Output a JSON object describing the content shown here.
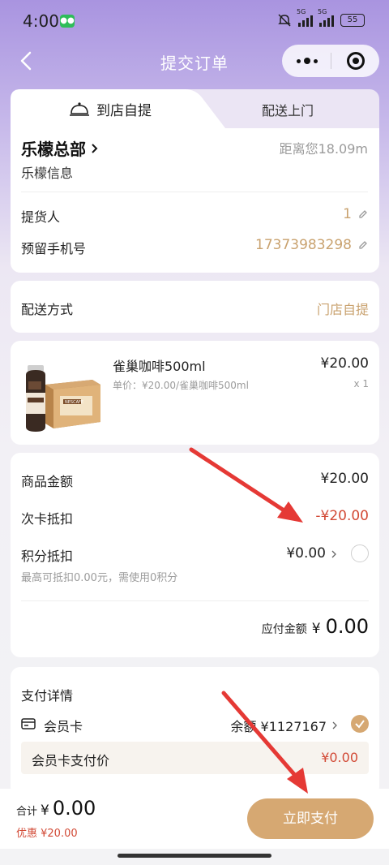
{
  "status_bar": {
    "time": "4:00",
    "network_1": "5G",
    "network_2": "5G",
    "battery": "55"
  },
  "nav": {
    "title": "提交订单"
  },
  "tabs": {
    "pickup": "到店自提",
    "delivery": "配送上门"
  },
  "store": {
    "name": "乐檬总部",
    "subtitle": "乐檬信息",
    "distance": "距离您18.09m",
    "pickup_person_label": "提货人",
    "pickup_person_value": "1",
    "phone_label": "预留手机号",
    "phone_value": "17373983298"
  },
  "delivery": {
    "label": "配送方式",
    "value": "门店自提"
  },
  "product": {
    "name": "雀巢咖啡500ml",
    "unit_price": "单价：¥20.00/雀巢咖啡500ml",
    "price": "¥20.00",
    "qty": "x 1"
  },
  "summary": {
    "goods_label": "商品金额",
    "goods_value": "¥20.00",
    "card_label": "次卡抵扣",
    "card_value": "-¥20.00",
    "points_label": "积分抵扣",
    "points_value": "¥0.00",
    "points_hint": "最高可抵扣0.00元，需使用0积分",
    "payable_label": "应付金额",
    "payable_currency": "¥",
    "payable_value": "0.00"
  },
  "payment": {
    "title": "支付详情",
    "member_card_label": "会员卡",
    "balance": "余额 ¥1127167",
    "member_price_label": "会员卡支付价",
    "member_price_value": "¥0.00"
  },
  "bottom": {
    "total_label": "合计",
    "total_currency": "¥",
    "total_value": "0.00",
    "discount": "优惠 ¥20.00",
    "pay_button": "立即支付"
  },
  "colors": {
    "accent_gold": "#c9a26f",
    "button": "#d6a872",
    "red": "#d24a36",
    "header_purple": "#a994e0"
  }
}
